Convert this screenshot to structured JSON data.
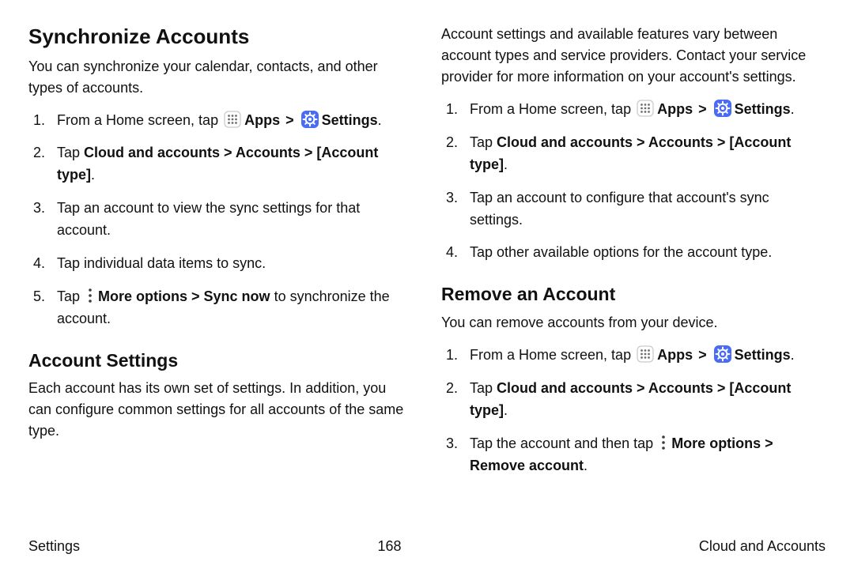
{
  "left_col": {
    "sync": {
      "heading": "Synchronize Accounts",
      "intro": "You can synchronize your calendar, contacts, and other types of accounts.",
      "step1_pre": "From a Home screen, tap ",
      "apps": "Apps",
      "settings": "Settings",
      "step2_pre": "Tap ",
      "step2_path": "Cloud and accounts > Accounts > [Account type]",
      "step3": "Tap an account to view the sync settings for that account.",
      "step4": "Tap individual data items to sync.",
      "step5_pre": "Tap ",
      "step5_more": "More options > Sync now",
      "step5_post": " to synchronize the account."
    },
    "acctsettings": {
      "heading": "Account Settings",
      "intro": "Each account has its own set of settings. In addition, you can configure common settings for all accounts of the same type."
    }
  },
  "right_col": {
    "top_para": "Account settings and available features vary between account types and service providers. Contact your service provider for more information on your account's settings.",
    "list1": {
      "step1_pre": "From a Home screen, tap ",
      "apps": "Apps",
      "settings": "Settings",
      "step2_pre": "Tap ",
      "step2_path": "Cloud and accounts > Accounts > [Account type]",
      "step3": "Tap an account to configure that account's sync settings.",
      "step4": "Tap other available options for the account type."
    },
    "remove": {
      "heading": "Remove an Account",
      "intro": "You can remove accounts from your device.",
      "step1_pre": "From a Home screen, tap ",
      "apps": "Apps",
      "settings": "Settings",
      "step2_pre": "Tap ",
      "step2_path": "Cloud and accounts > Accounts > [Account type]",
      "step3_pre": "Tap the account and then tap ",
      "step3_more": "More options > Remove account"
    }
  },
  "footer": {
    "left": "Settings",
    "center": "168",
    "right": "Cloud and Accounts"
  },
  "glyph": {
    "chevron": ">",
    "period": "."
  }
}
